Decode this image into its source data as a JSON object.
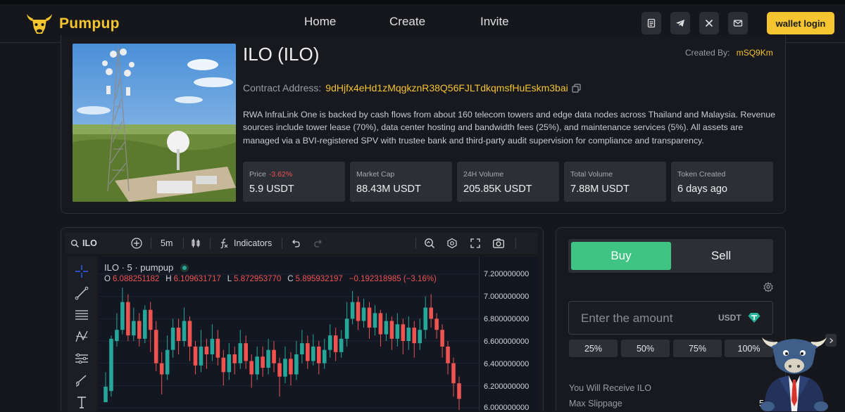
{
  "app": {
    "brand": "Pumpup"
  },
  "nav": {
    "links": [
      "Home",
      "Create",
      "Invite"
    ],
    "wallet_label": "wallet login"
  },
  "token": {
    "title": "ILO (ILO)",
    "created_by_label": "Created By:",
    "creator": "mSQ9Km",
    "contract_label": "Contract Address:",
    "contract_address": "9dHjfx4eHd1zMqgkznR38Q56FJLTdkqmsfHuEskm3bai",
    "description": "RWA InfraLink One is backed by cash flows from about 160 telecom towers and edge data nodes across Thailand and Malaysia. Revenue sources include tower lease (70%), data center hosting and bandwidth fees (25%), and maintenance services (5%). All assets are managed via a BVI-registered SPV with trustee bank and third-party audit supervision for compliance and transparency.",
    "stats": [
      {
        "label": "Price",
        "change": "-3.62%",
        "value": "5.9 USDT"
      },
      {
        "label": "Market Cap",
        "change": "",
        "value": "88.43M USDT"
      },
      {
        "label": "24H Volume",
        "change": "",
        "value": "205.85K USDT"
      },
      {
        "label": "Total Volume",
        "change": "",
        "value": "7.88M USDT"
      },
      {
        "label": "Token Created",
        "change": "",
        "value": "6 days ago"
      }
    ]
  },
  "chart_toolbar": {
    "symbol": "ILO",
    "interval": "5m",
    "indicators": "Indicators"
  },
  "chart_legend": {
    "title": "ILO · 5 · pumpup",
    "o_label": "O",
    "o": "6.088251182",
    "h_label": "H",
    "h": "6.109631717",
    "l_label": "L",
    "l": "5.872953770",
    "c_label": "C",
    "c": "5.895932197",
    "change": "−0.192318985 (−3.16%)"
  },
  "chart_data": {
    "type": "candlestick",
    "title": "",
    "price_ticks": [
      "7.200000000",
      "7.000000000",
      "6.800000000",
      "6.600000000",
      "6.400000000",
      "6.200000000",
      "6.000000000"
    ],
    "ylim": [
      6.0,
      7.2
    ],
    "up_color": "#26a69a",
    "down_color": "#ef5350",
    "candles": [
      [
        6.05,
        6.19,
        6.15,
        6.32
      ],
      [
        6.15,
        6.62,
        6.1,
        6.65
      ],
      [
        6.6,
        6.7,
        6.55,
        6.85
      ],
      [
        6.7,
        6.95,
        6.66,
        7.08
      ],
      [
        6.95,
        6.65,
        6.6,
        7.02
      ],
      [
        6.65,
        6.78,
        6.6,
        6.9
      ],
      [
        6.78,
        6.62,
        6.55,
        6.85
      ],
      [
        6.62,
        6.88,
        6.58,
        6.92
      ],
      [
        6.88,
        6.7,
        6.5,
        6.95
      ],
      [
        6.7,
        6.4,
        6.33,
        6.78
      ],
      [
        6.4,
        6.3,
        6.12,
        6.5
      ],
      [
        6.3,
        6.52,
        6.25,
        6.65
      ],
      [
        6.52,
        6.72,
        6.45,
        6.8
      ],
      [
        6.72,
        6.6,
        6.48,
        6.8
      ],
      [
        6.6,
        6.78,
        6.55,
        6.9
      ],
      [
        6.78,
        6.55,
        6.42,
        6.82
      ],
      [
        6.55,
        6.38,
        6.3,
        6.6
      ],
      [
        6.38,
        6.55,
        6.32,
        6.7
      ],
      [
        6.55,
        6.48,
        6.35,
        6.62
      ],
      [
        6.48,
        6.62,
        6.42,
        6.75
      ],
      [
        6.62,
        6.45,
        6.38,
        6.7
      ],
      [
        6.45,
        6.32,
        6.2,
        6.52
      ],
      [
        6.32,
        6.48,
        6.25,
        6.58
      ],
      [
        6.48,
        6.4,
        6.3,
        6.55
      ],
      [
        6.4,
        6.58,
        6.35,
        6.7
      ],
      [
        6.58,
        6.42,
        6.35,
        6.65
      ],
      [
        6.42,
        6.3,
        6.18,
        6.48
      ],
      [
        6.3,
        6.46,
        6.25,
        6.55
      ],
      [
        6.46,
        6.36,
        6.28,
        6.55
      ],
      [
        6.36,
        6.52,
        6.3,
        6.62
      ],
      [
        6.52,
        6.4,
        6.32,
        6.6
      ],
      [
        6.4,
        6.28,
        6.1,
        6.45
      ],
      [
        6.28,
        6.44,
        6.22,
        6.55
      ],
      [
        6.44,
        6.3,
        6.2,
        6.5
      ],
      [
        6.3,
        6.48,
        6.25,
        6.6
      ],
      [
        6.48,
        6.58,
        6.4,
        6.7
      ],
      [
        6.58,
        6.42,
        6.35,
        6.65
      ],
      [
        6.42,
        6.55,
        6.38,
        6.66
      ],
      [
        6.55,
        6.4,
        6.3,
        6.6
      ],
      [
        6.4,
        6.52,
        6.35,
        6.62
      ],
      [
        6.52,
        6.65,
        6.45,
        6.75
      ],
      [
        6.65,
        6.5,
        6.42,
        6.72
      ],
      [
        6.5,
        6.62,
        6.45,
        6.7
      ],
      [
        6.62,
        6.8,
        6.55,
        6.95
      ],
      [
        6.8,
        6.95,
        6.75,
        7.05
      ],
      [
        6.95,
        6.78,
        6.7,
        7.0
      ],
      [
        6.78,
        6.9,
        6.72,
        6.98
      ],
      [
        6.9,
        6.72,
        6.62,
        6.95
      ],
      [
        6.72,
        6.85,
        6.65,
        6.92
      ],
      [
        6.85,
        6.66,
        6.55,
        6.88
      ],
      [
        6.66,
        6.78,
        6.6,
        6.85
      ],
      [
        6.78,
        6.62,
        6.52,
        6.82
      ],
      [
        6.62,
        6.75,
        6.55,
        6.85
      ],
      [
        6.75,
        6.6,
        6.48,
        6.8
      ],
      [
        6.6,
        6.72,
        6.52,
        6.82
      ],
      [
        6.72,
        6.58,
        6.45,
        6.78
      ],
      [
        6.58,
        6.7,
        6.52,
        6.8
      ],
      [
        6.7,
        6.9,
        6.62,
        7.0
      ],
      [
        6.9,
        6.8,
        6.72,
        7.02
      ],
      [
        6.8,
        6.7,
        6.62,
        6.85
      ],
      [
        6.7,
        6.55,
        6.45,
        6.75
      ],
      [
        6.55,
        6.4,
        6.3,
        6.6
      ],
      [
        6.4,
        6.22,
        6.1,
        6.45
      ],
      [
        6.22,
        6.08,
        5.98,
        6.28
      ]
    ]
  },
  "trade": {
    "buy_label": "Buy",
    "sell_label": "Sell",
    "amount_placeholder": "Enter the amount",
    "unit": "USDT",
    "percents": [
      "25%",
      "50%",
      "75%",
      "100%"
    ],
    "receive_label": "You Will Receive ILO",
    "slippage_label": "Max Slippage",
    "slippage_value": "5"
  }
}
